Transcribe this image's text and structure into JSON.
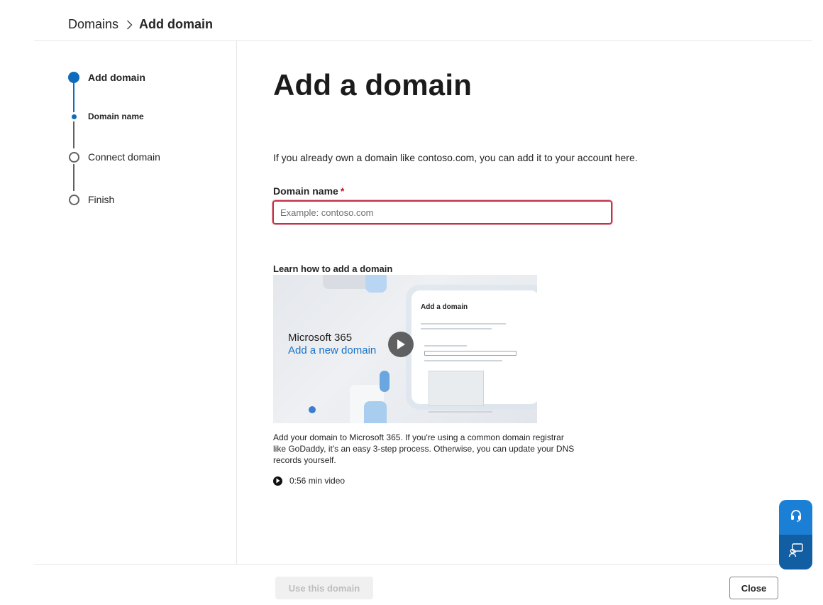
{
  "breadcrumb": {
    "parent": "Domains",
    "current": "Add domain"
  },
  "stepper": {
    "steps": [
      {
        "label": "Add domain",
        "state": "current"
      },
      {
        "label": "Domain name",
        "state": "current-sub"
      },
      {
        "label": "Connect domain",
        "state": "upcoming"
      },
      {
        "label": "Finish",
        "state": "upcoming"
      }
    ]
  },
  "main": {
    "title": "Add a domain",
    "intro": "If you already own a domain like contoso.com, you can add it to your account here.",
    "field_label": "Domain name",
    "required_mark": "*",
    "input_value": "",
    "input_placeholder": "Example: contoso.com",
    "learn_title": "Learn how to add a domain",
    "video": {
      "product": "Microsoft 365",
      "subtitle": "Add a new domain",
      "panel_title": "Add a domain",
      "description": "Add your domain to Microsoft 365. If you're using a common domain registrar like GoDaddy, it's an easy 3-step process. Otherwise, you can update your DNS records yourself.",
      "duration": "0:56 min video"
    }
  },
  "footer": {
    "primary": "Use this domain",
    "close": "Close"
  },
  "icons": {
    "breadcrumb_sep": "chevron-right-icon",
    "play": "play-icon",
    "help": "headset-icon",
    "feedback": "feedback-icon"
  },
  "colors": {
    "accent": "#0f6cbd",
    "error_border": "#c4314b",
    "help_top": "#1b7fd6",
    "help_bottom": "#115ea3"
  }
}
